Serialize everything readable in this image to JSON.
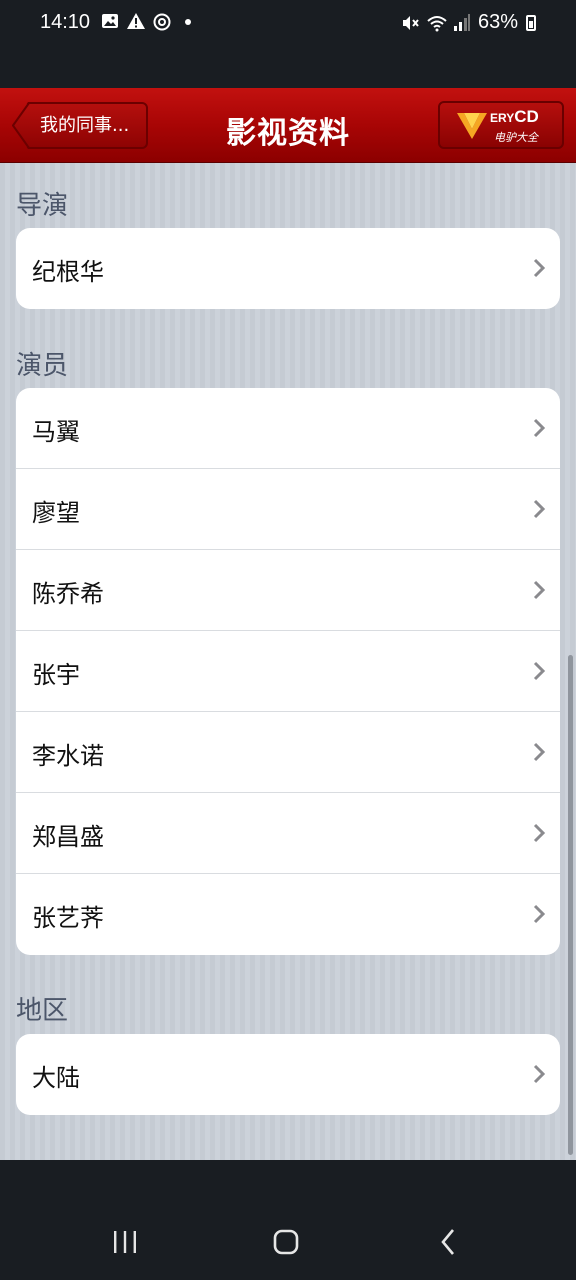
{
  "status_bar": {
    "time": "14:10",
    "battery": "63%",
    "left_icons": [
      "image-icon",
      "warning-icon",
      "sync-icon",
      "dot-icon"
    ],
    "right_icons": [
      "mute-icon",
      "wifi-icon",
      "signal-icon",
      "battery-icon"
    ]
  },
  "navbar": {
    "back_label": "我的同事...",
    "title": "影视资料",
    "logo": {
      "text_main": "ERY",
      "text_cd": "CD",
      "subtitle": "电驴大全"
    }
  },
  "sections": [
    {
      "header": "导演",
      "items": [
        "纪根华"
      ]
    },
    {
      "header": "演员",
      "items": [
        "马翼",
        "廖望",
        "陈乔希",
        "张宇",
        "李水诺",
        "郑昌盛",
        "张艺荠"
      ]
    },
    {
      "header": "地区",
      "items": [
        "大陆"
      ]
    }
  ],
  "colors": {
    "navbar": "#a80505",
    "background": "#c8ced6",
    "accent_logo": "#f5a623"
  }
}
